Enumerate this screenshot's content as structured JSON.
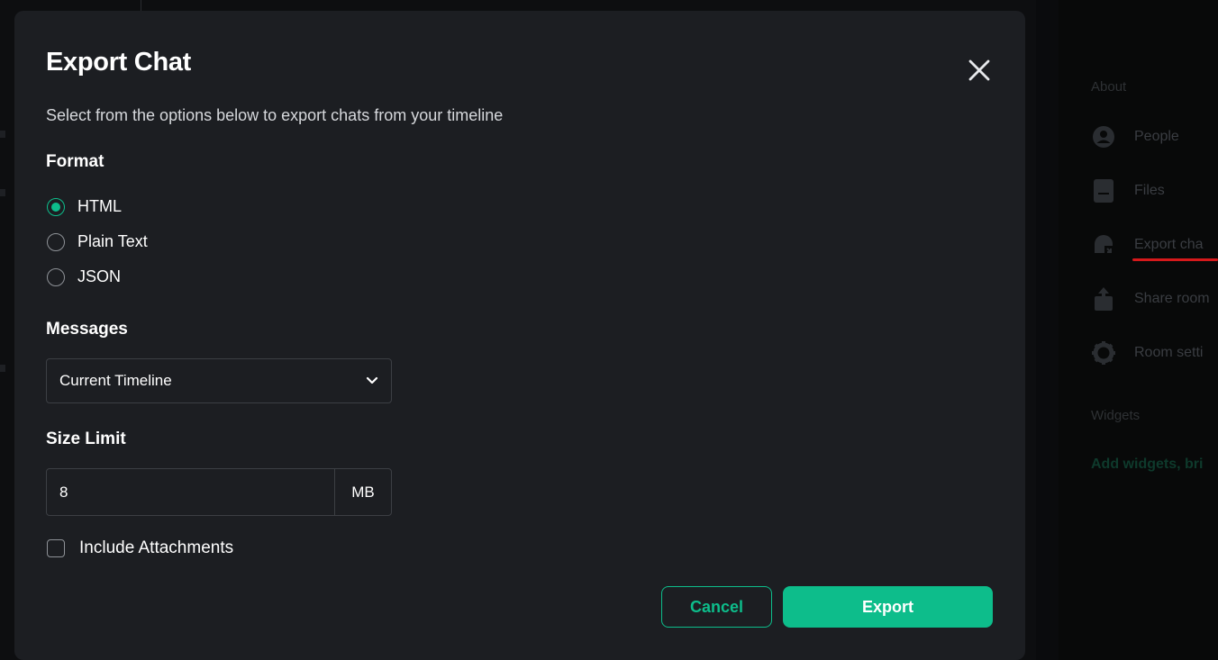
{
  "modal": {
    "title": "Export Chat",
    "subtitle": "Select from the options below to export chats from your timeline",
    "format": {
      "heading": "Format",
      "options": [
        {
          "label": "HTML",
          "checked": true
        },
        {
          "label": "Plain Text",
          "checked": false
        },
        {
          "label": "JSON",
          "checked": false
        }
      ]
    },
    "messages": {
      "heading": "Messages",
      "selected": "Current Timeline"
    },
    "size_limit": {
      "heading": "Size Limit",
      "value": "8",
      "unit": "MB"
    },
    "attachments": {
      "label": "Include Attachments",
      "checked": false
    },
    "buttons": {
      "cancel": "Cancel",
      "export": "Export"
    }
  },
  "right_panel": {
    "about_label": "About",
    "items": [
      {
        "label": "People",
        "icon": "person-icon"
      },
      {
        "label": "Files",
        "icon": "file-icon"
      },
      {
        "label": "Export cha",
        "icon": "export-chat-icon"
      },
      {
        "label": "Share room",
        "icon": "share-icon"
      },
      {
        "label": "Room setti",
        "icon": "gear-icon"
      }
    ],
    "widgets_label": "Widgets",
    "add_widgets": "Add widgets, bri"
  },
  "colors": {
    "accent": "#0dbd8b",
    "modal_bg": "#1c1e22",
    "highlight": "#d6191b"
  }
}
